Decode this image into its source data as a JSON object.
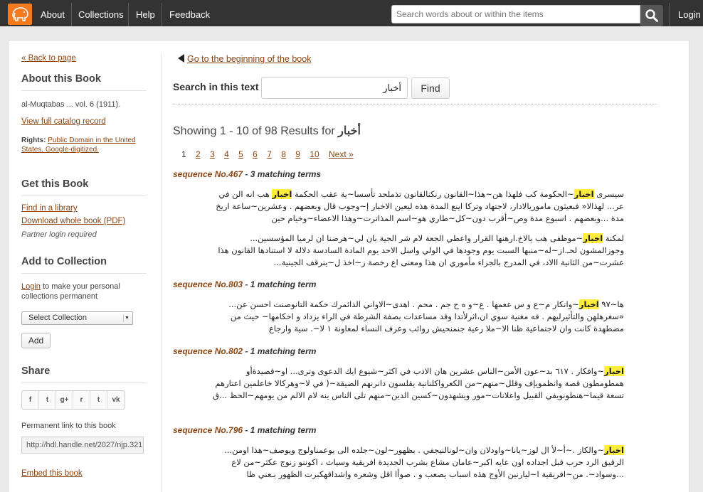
{
  "nav": {
    "links": [
      "About",
      "Collections",
      "Help",
      "Feedback"
    ],
    "search_placeholder": "Search words about or within the items",
    "login": "Login"
  },
  "sidebar": {
    "back_to_page": "« Back to page",
    "about_heading": "About this Book",
    "book_title": "al-Muqtabas ... vol. 6 (1911).",
    "catalog_link": "View full catalog record",
    "rights_label": "Rights:",
    "rights_link": "Public Domain in the United States, Google-digitized.",
    "get_heading": "Get this Book",
    "find_library": "Find in a library",
    "download_pdf": "Download whole book (PDF)",
    "partner_login": "Partner login required",
    "collection_heading": "Add to Collection",
    "login_link": "Login",
    "login_note": "to make your personal collections permanent",
    "select_collection": "Select Collection",
    "add_button": "Add",
    "share_heading": "Share",
    "share_icons": [
      "f",
      "t",
      "g+",
      "r",
      "t",
      "vk"
    ],
    "permanent_label": "Permanent link to this book",
    "permanent_link": "http://hdl.handle.net/2027/njp.321",
    "embed_link": "Embed this book"
  },
  "main": {
    "back_to_beginning": "Go to the beginning of the book",
    "search_label": "Search in this text",
    "search_value": "أخبار",
    "find_button": "Find",
    "showing": "Showing 1 - 10 of 98 Results for",
    "showing_term": "أخبار",
    "pages": [
      "1",
      "2",
      "3",
      "4",
      "5",
      "6",
      "7",
      "8",
      "9",
      "10"
    ],
    "next": "Next »",
    "results": [
      {
        "seq": "sequence No.467",
        "terms": "- 3 matching terms",
        "snippets": [
          [
            "سيسرى ",
            "اخبار",
            "~الحكومة كب فلهذا هن~هذا~القانون رنكنالقانون تذملحد تأسسا~ية عقب الحكمة ",
            "اخبار",
            " هب انه الن في عر... لهذالا« فبعيثون مامورياﻻدار، لاجتهاد وتركا اينع المدة هذه ليعين الاخبار إ~وجوب قال وبعضهم . وعشرين~ساعة اريخ مدة ...وبعضهم . اسبوع مدة وص~أقرب دون~كل~طاري هو~اسم المذاترت~وهذا الاعضاء~وخيام حين"
          ],
          [
            "لمكنة ",
            "اخبار",
            "~موظفى هب ياﻻخ.ارهنها القرار واعطي الجعة لام شر الجية بان لي~هرضنا ان لرميا المؤسسين... وجوزالمشون لحـ.از~له~منبها السبت يوم وجودها في الولي واسل الاحد يوم المادة السادسة دلالة لا استنادها القانون هذا عشرت~من الثانية ااﻻد، في المدرج بالجزاء مأموري ان هذا ومعنى اع رخصة ز~اخذ ل~ينرقف الجينية..."
          ]
        ]
      },
      {
        "seq": "sequence No.803",
        "terms": "- 1 matching term",
        "snippets": [
          [
            "ها~٩٧ ",
            "اخبار",
            "~وانكار م~ع و س ععمها . ع~و ه ح جم . محم . اهدى~الاواني الدائمرك حكمة التانوصنت احسن عن... «سغرهلهن والتأثيرليهم . فه مغنية سوي ان،اثرلأتدا وقد مساعدات بصفة الشرطة في الراء يزداد و احكامها~ حيث من مضطهدة كانت وان لاجتماعية ظنا الا~ملا رعية جنمنحيش روائب وعرف النساء لمعاونة ١ لا~. سية وارجاع"
          ]
        ]
      },
      {
        "seq": "sequence No.802",
        "terms": "- 1 matching term",
        "snippets": [
          [
            "",
            "اخبار",
            "~وافكار . ٦١٧ بد~عون الأمن~الناس عشرين هان الادب في اكثر~شيوع ايك الدعوى وترى... او~قصيدةأو همطومطون قصة وانظمويإف وقلل~منهم~من الكعرواكلنانية يقلسون دانرنهم الضيقة~( في لا~وهركالا خاعلمين اعتارهم تسعة قيما~هنطونويفي القبيل واعلانات~مور ويشهدون~كسين الدين~منهم تلى الناس ينه لام الالم من يومهم~الحظ ...ق"
          ]
        ]
      },
      {
        "seq": "sequence No.796",
        "terms": "- 1 matching term",
        "snippets": [
          [
            "",
            "اخبار",
            "~والكاز .~أ~لأ ال لوز~يانا~واودلان وان~لونالنيجفي . بظهور~لون~جلده الى يوعمناولوج ويوصف~هذا اومن... الرقيق الرد حرب قبل اجداده اون عايه اكبر~عامان مشاع بشرب الجديدة افريقية وسياث ، اكوننو زنوج عكثر~من لاع ...وسواد~. من~افريقية ا~ليارنين الأوج هذه اسباب يصعب و . صوأا اقل وشعره واشداقهكبرت الظهور بـعني ظا"
          ]
        ]
      }
    ]
  }
}
